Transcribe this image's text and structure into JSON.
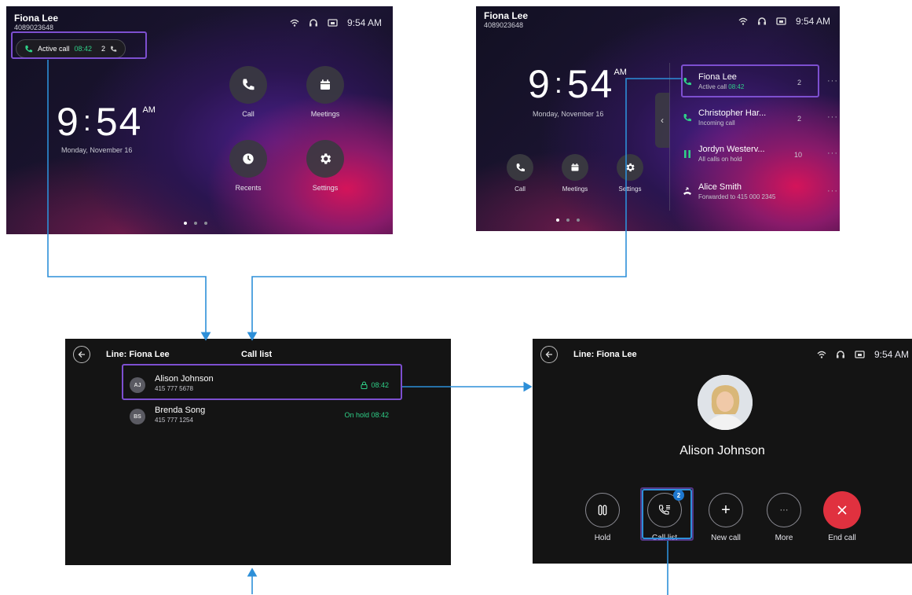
{
  "colors": {
    "accent_green": "#2fd088",
    "highlight_purple": "#7d4fd0",
    "arrow_blue": "#2d8fd8",
    "end_red": "#e0313f"
  },
  "screen1": {
    "user_name": "Fiona Lee",
    "user_number": "4089023648",
    "time": "9:54 AM",
    "active_call": {
      "label": "Active call",
      "timer": "08:42",
      "count": "2"
    },
    "clock": {
      "hour": "9",
      "minute": "54",
      "ampm": "AM"
    },
    "date": "Monday, November 16",
    "apps": [
      {
        "label": "Call",
        "icon": "phone-icon"
      },
      {
        "label": "Meetings",
        "icon": "calendar-icon"
      },
      {
        "label": "Recents",
        "icon": "clock-icon"
      },
      {
        "label": "Settings",
        "icon": "gear-icon"
      }
    ],
    "page_dots": 3
  },
  "screen2": {
    "user_name": "Fiona Lee",
    "user_number": "4089023648",
    "time": "9:54 AM",
    "clock": {
      "hour": "9",
      "minute": "54",
      "ampm": "AM"
    },
    "date": "Monday, November 16",
    "apps": [
      {
        "label": "Call",
        "icon": "phone-icon"
      },
      {
        "label": "Meetings",
        "icon": "calendar-icon"
      },
      {
        "label": "Settings",
        "icon": "gear-icon"
      }
    ],
    "lines": [
      {
        "name": "Fiona Lee",
        "status_prefix": "Active call",
        "status_timer": "08:42",
        "count": "2",
        "icon": "phone-active-icon"
      },
      {
        "name": "Christopher Har...",
        "status_prefix": "Incoming call",
        "status_timer": "",
        "count": "2",
        "icon": "phone-incoming-icon"
      },
      {
        "name": "Jordyn Westerv...",
        "status_prefix": "All calls on hold",
        "status_timer": "",
        "count": "10",
        "icon": "pause-icon"
      },
      {
        "name": "Alice Smith",
        "status_prefix": "Forwarded to 415 000 2345",
        "status_timer": "",
        "count": "",
        "icon": "phone-forward-icon"
      }
    ],
    "more": "···"
  },
  "screen3": {
    "line_label": "Line: Fiona Lee",
    "title": "Call list",
    "calls": [
      {
        "initials": "AJ",
        "name": "Alison Johnson",
        "number": "415 777 5678",
        "status": "08:42"
      },
      {
        "initials": "BS",
        "name": "Brenda Song",
        "number": "415 777 1254",
        "status": "On hold 08:42"
      }
    ]
  },
  "screen4": {
    "line_label": "Line: Fiona Lee",
    "time": "9:54 AM",
    "contact_name": "Alison Johnson",
    "call_list_badge": "2",
    "controls": [
      {
        "label": "Hold",
        "icon": "pause-icon"
      },
      {
        "label": "Call list",
        "icon": "call-list-icon"
      },
      {
        "label": "New call",
        "icon": "plus-icon"
      },
      {
        "label": "More",
        "icon": "more-icon"
      },
      {
        "label": "End call",
        "icon": "close-icon"
      }
    ]
  }
}
